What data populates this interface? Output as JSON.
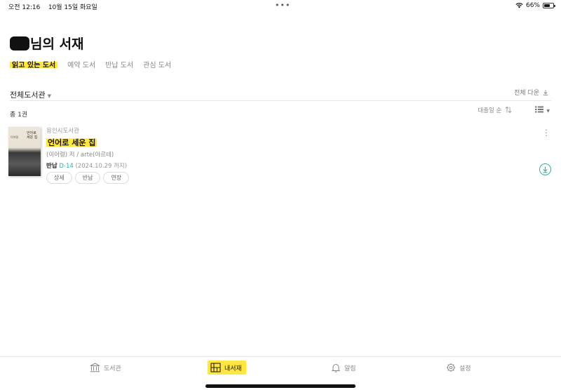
{
  "status_bar": {
    "time": "오전 12:16",
    "date": "10월 15일 화요일",
    "dots": "•••",
    "battery": "66%",
    "battery_level": 0.66
  },
  "header": {
    "title_suffix": "님의 서재"
  },
  "tabs": [
    {
      "label": "읽고 있는 도서",
      "active": true
    },
    {
      "label": "예약 도서",
      "active": false
    },
    {
      "label": "반납 도서",
      "active": false
    },
    {
      "label": "관심 도서",
      "active": false
    }
  ],
  "filter": {
    "library_filter": "전체도서관",
    "download_all": "전체 다운"
  },
  "list": {
    "count": "총 1권",
    "sort": "대출일 순"
  },
  "book": {
    "library": "용인시도서관",
    "title": "언어로 세운 집",
    "author": "(이어령) 저 / arte(아르테)",
    "due_label": "반납",
    "due_dday": "D-14",
    "due_date": "(2024.10.29 까지)",
    "buttons": [
      "상세",
      "반납",
      "연장"
    ],
    "cover_title": "언어로 세운 집",
    "cover_author": "이어령"
  },
  "bottom_nav": [
    {
      "label": "도서관",
      "icon": "library-icon",
      "active": false
    },
    {
      "label": "내서재",
      "icon": "bookshelf-icon",
      "active": true
    },
    {
      "label": "알림",
      "icon": "bell-icon",
      "active": false
    },
    {
      "label": "설정",
      "icon": "gear-icon",
      "active": false
    }
  ],
  "colors": {
    "accent_yellow": "#ffe640",
    "teal": "#25b8a5"
  }
}
